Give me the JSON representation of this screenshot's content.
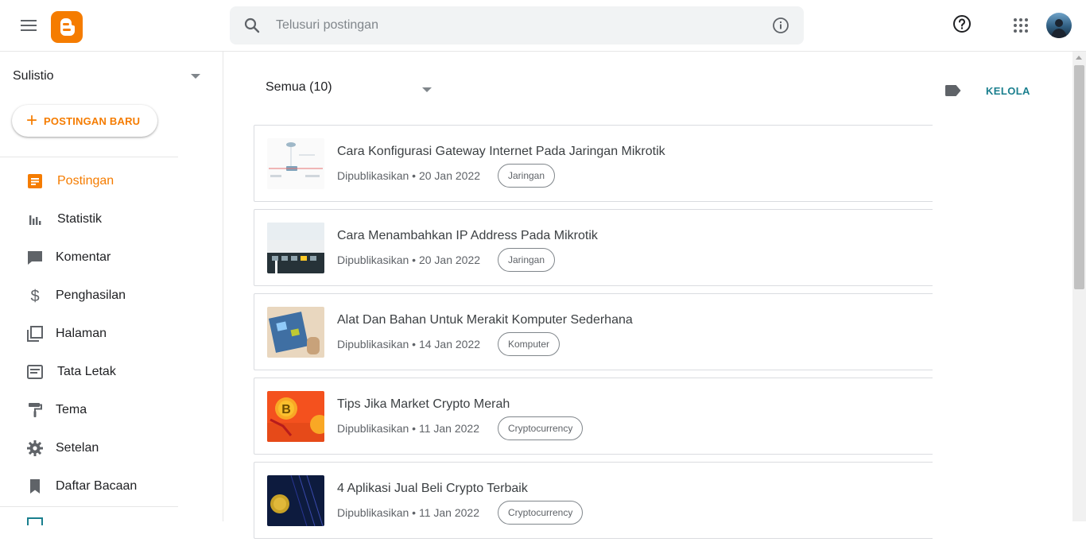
{
  "topbar": {
    "search_placeholder": "Telusuri postingan"
  },
  "sidebar": {
    "blog_name": "Sulistio",
    "new_post_label": "POSTINGAN BARU",
    "items": [
      {
        "label": "Postingan",
        "icon": "posts-icon"
      },
      {
        "label": "Statistik",
        "icon": "stats-icon"
      },
      {
        "label": "Komentar",
        "icon": "comment-icon"
      },
      {
        "label": "Penghasilan",
        "icon": "dollar-icon"
      },
      {
        "label": "Halaman",
        "icon": "pages-icon"
      },
      {
        "label": "Tata Letak",
        "icon": "layout-icon"
      },
      {
        "label": "Tema",
        "icon": "paint-roller-icon"
      },
      {
        "label": "Setelan",
        "icon": "gear-icon"
      },
      {
        "label": "Daftar Bacaan",
        "icon": "bookmark-icon"
      }
    ]
  },
  "main": {
    "filter_label": "Semua (10)",
    "manage_label": "KELOLA",
    "posts": [
      {
        "title": "Cara Konfigurasi Gateway Internet Pada Jaringan Mikrotik",
        "meta": "Dipublikasikan • 20 Jan 2022",
        "tag": "Jaringan"
      },
      {
        "title": "Cara Menambahkan IP Address Pada Mikrotik",
        "meta": "Dipublikasikan • 20 Jan 2022",
        "tag": "Jaringan"
      },
      {
        "title": "Alat Dan Bahan Untuk Merakit Komputer Sederhana",
        "meta": "Dipublikasikan • 14 Jan 2022",
        "tag": "Komputer"
      },
      {
        "title": "Tips Jika Market Crypto Merah",
        "meta": "Dipublikasikan • 11 Jan 2022",
        "tag": "Cryptocurrency"
      },
      {
        "title": "4 Aplikasi Jual Beli Crypto Terbaik",
        "meta": "Dipublikasikan • 11 Jan 2022",
        "tag": "Cryptocurrency"
      }
    ]
  },
  "colors": {
    "accent": "#f57c00",
    "link": "#1a7f8e"
  }
}
